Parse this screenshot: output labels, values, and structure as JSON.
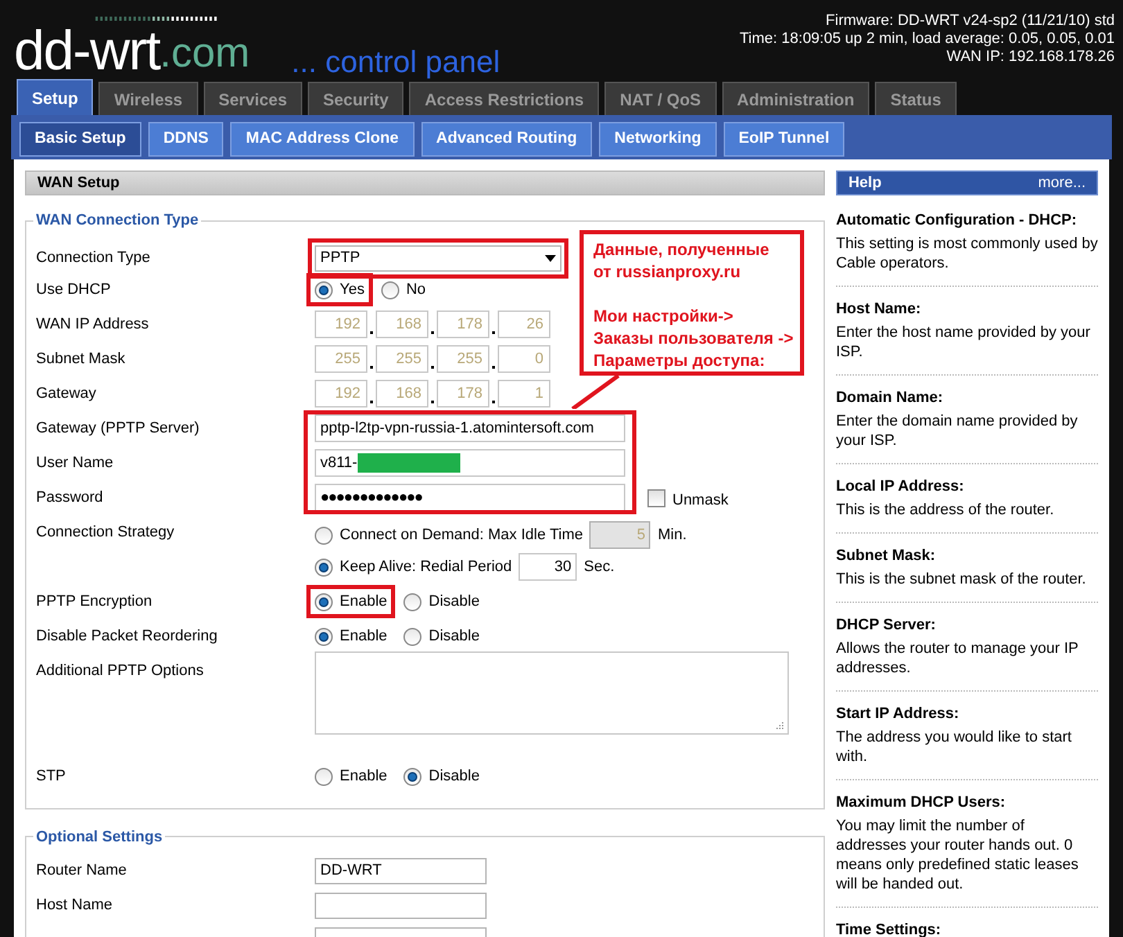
{
  "header": {
    "logo_main": "dd-wrt",
    "logo_suffix": ".com",
    "tagline": "... control panel",
    "firmware": "Firmware: DD-WRT v24-sp2 (11/21/10) std",
    "time": "Time: 18:09:05 up 2 min, load average: 0.05, 0.05, 0.01",
    "wan_ip": "WAN IP: 192.168.178.26"
  },
  "tabs": [
    {
      "label": "Setup",
      "selected": true
    },
    {
      "label": "Wireless",
      "selected": false
    },
    {
      "label": "Services",
      "selected": false
    },
    {
      "label": "Security",
      "selected": false
    },
    {
      "label": "Access Restrictions",
      "selected": false
    },
    {
      "label": "NAT / QoS",
      "selected": false
    },
    {
      "label": "Administration",
      "selected": false
    },
    {
      "label": "Status",
      "selected": false
    }
  ],
  "subtabs": [
    {
      "label": "Basic Setup",
      "selected": true
    },
    {
      "label": "DDNS",
      "selected": false
    },
    {
      "label": "MAC Address Clone",
      "selected": false
    },
    {
      "label": "Advanced Routing",
      "selected": false
    },
    {
      "label": "Networking",
      "selected": false
    },
    {
      "label": "EoIP Tunnel",
      "selected": false
    }
  ],
  "section_title": "WAN Setup",
  "wan": {
    "legend": "WAN Connection Type",
    "callout": [
      [
        "Данные, полученные",
        "от russianproxy.ru"
      ],
      [
        "Мои настройки->",
        "Заказы пользователя ->",
        "Параметры доступа:"
      ]
    ],
    "rows": [
      {
        "kind": "select",
        "label": "Connection Type",
        "value": "PPTP",
        "highlighted": true
      },
      {
        "kind": "radio",
        "label": "Use DHCP",
        "options": [
          {
            "label": "Yes",
            "selected": true,
            "highlighted": true
          },
          {
            "label": "No",
            "selected": false,
            "highlighted": false
          }
        ]
      },
      {
        "kind": "ip",
        "label": "WAN IP Address",
        "disabled": true,
        "octets": [
          "192",
          "168",
          "178",
          "26"
        ]
      },
      {
        "kind": "ip",
        "label": "Subnet Mask",
        "disabled": true,
        "octets": [
          "255",
          "255",
          "255",
          "0"
        ]
      },
      {
        "kind": "ip",
        "label": "Gateway",
        "disabled": true,
        "octets": [
          "192",
          "168",
          "178",
          "1"
        ]
      },
      {
        "kind": "group",
        "highlighted": true,
        "rows": [
          {
            "kind": "text",
            "label": "Gateway (PPTP Server)",
            "value": "pptp-l2tp-vpn-russia-1.atomintersoft.com"
          },
          {
            "kind": "text",
            "label": "User Name",
            "value": "v811-",
            "redacted": true
          },
          {
            "kind": "password",
            "label": "Password",
            "value": "●●●●●●●●●●●●●",
            "checkbox": {
              "label": "Unmask",
              "checked": false
            }
          }
        ]
      },
      {
        "kind": "strategy",
        "label": "Connection Strategy",
        "options": [
          {
            "label": "Connect on Demand: Max Idle Time",
            "selected": false,
            "value": "5",
            "unit": "Min.",
            "disabled": true
          },
          {
            "label": "Keep Alive: Redial Period",
            "selected": true,
            "value": "30",
            "unit": "Sec.",
            "disabled": false
          }
        ]
      },
      {
        "kind": "radio",
        "label": "PPTP Encryption",
        "options": [
          {
            "label": "Enable",
            "selected": true,
            "highlighted": true
          },
          {
            "label": "Disable",
            "selected": false,
            "highlighted": false
          }
        ]
      },
      {
        "kind": "radio",
        "label": "Disable Packet Reordering",
        "options": [
          {
            "label": "Enable",
            "selected": true,
            "highlighted": false
          },
          {
            "label": "Disable",
            "selected": false,
            "highlighted": false
          }
        ]
      },
      {
        "kind": "textarea",
        "label": "Additional PPTP Options"
      },
      {
        "kind": "radio",
        "label": "STP",
        "options": [
          {
            "label": "Enable",
            "selected": false,
            "highlighted": false
          },
          {
            "label": "Disable",
            "selected": true,
            "highlighted": false
          }
        ]
      }
    ]
  },
  "optional": {
    "legend": "Optional Settings",
    "rows": [
      {
        "kind": "short",
        "label": "Router Name",
        "value": "DD-WRT"
      },
      {
        "kind": "short",
        "label": "Host Name"
      },
      {
        "kind": "short"
      }
    ]
  },
  "help": {
    "title": "Help",
    "more": "more...",
    "entries": [
      {
        "title": "Automatic Configuration - DHCP:",
        "text": "This setting is most commonly used by Cable operators."
      },
      {
        "title": "Host Name:",
        "text": "Enter the host name provided by your ISP."
      },
      {
        "title": "Domain Name:",
        "text": "Enter the domain name provided by your ISP."
      },
      {
        "title": "Local IP Address:",
        "text": "This is the address of the router."
      },
      {
        "title": "Subnet Mask:",
        "text": "This is the subnet mask of the router."
      },
      {
        "title": "DHCP Server:",
        "text": "Allows the router to manage your IP addresses."
      },
      {
        "title": "Start IP Address:",
        "text": "The address you would like to start with."
      },
      {
        "title": "Maximum DHCP Users:",
        "text": "You may limit the number of addresses your router hands out. 0 means only predefined static leases will be handed out."
      },
      {
        "title": "Time Settings:"
      }
    ]
  }
}
